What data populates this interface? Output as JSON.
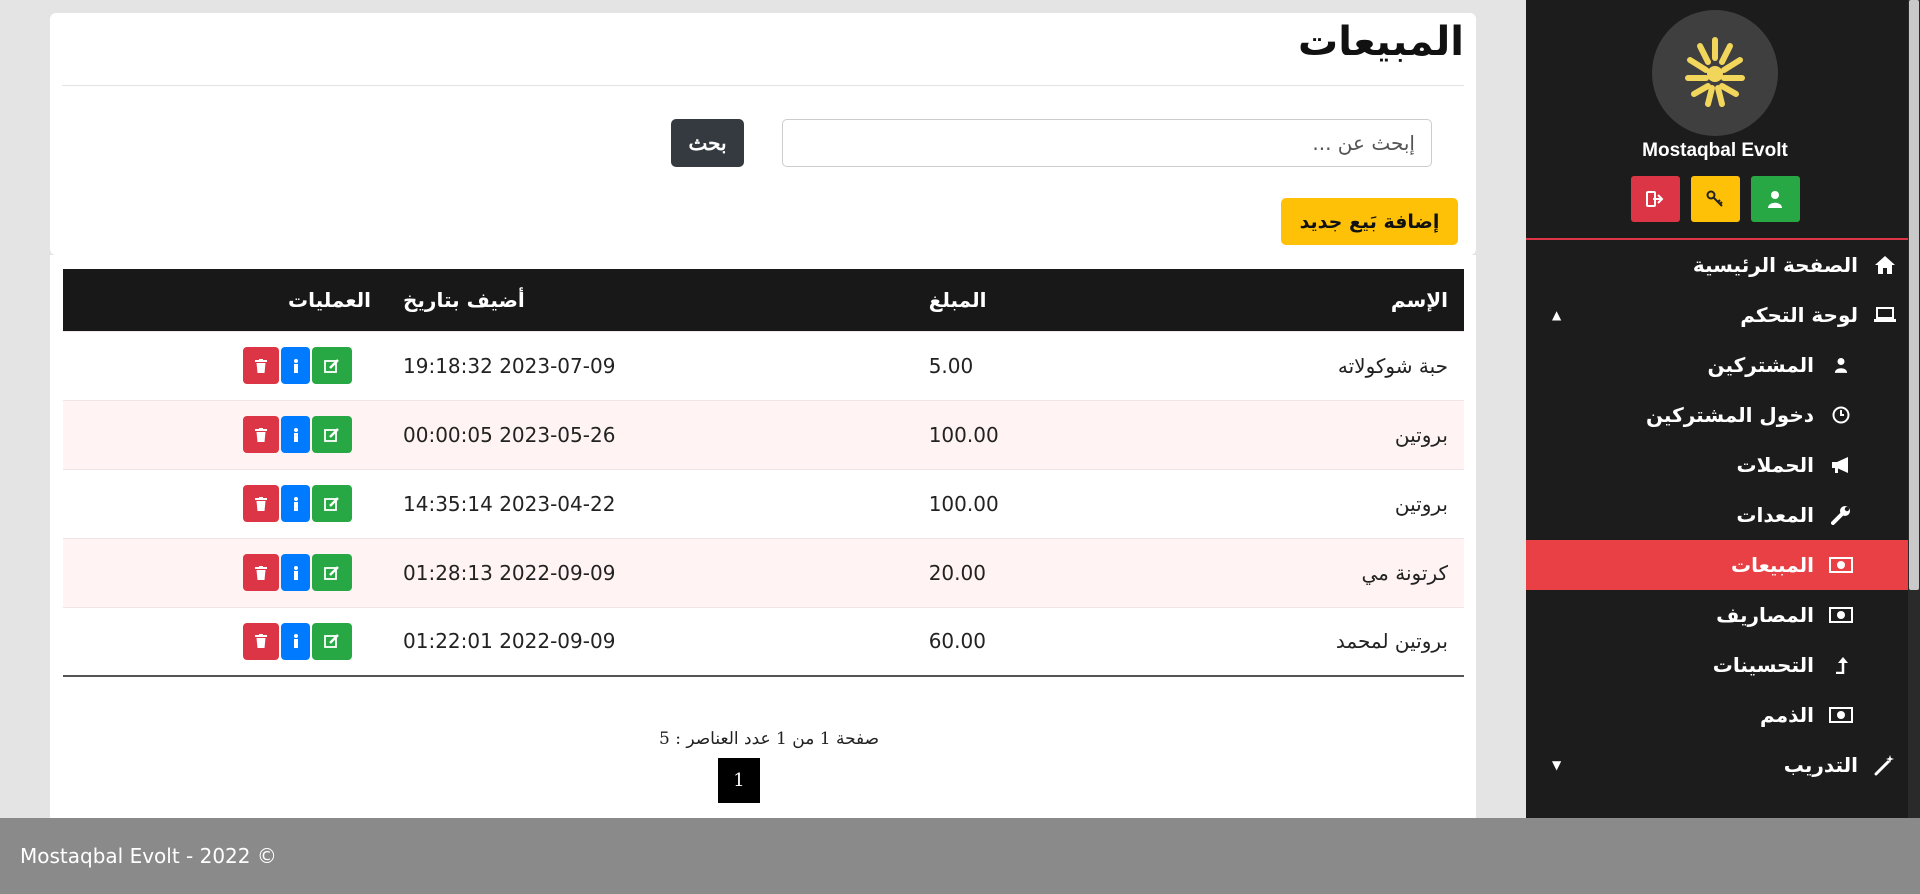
{
  "sidebar": {
    "brand": "Mostaqbal Evolt",
    "quick_buttons": [
      "logout-icon",
      "key-icon",
      "user-icon"
    ],
    "items": [
      {
        "label": "الصفحة الرئيسية",
        "icon": "home-icon"
      },
      {
        "label": "لوحة التحكم",
        "icon": "laptop-icon",
        "caret": "▲"
      },
      {
        "label": "المشتركين",
        "icon": "user-icon"
      },
      {
        "label": "دخول المشتركين",
        "icon": "clock-icon"
      },
      {
        "label": "الحملات",
        "icon": "megaphone-icon"
      },
      {
        "label": "المعدات",
        "icon": "wrench-icon"
      },
      {
        "label": "المبيعات",
        "icon": "money-icon"
      },
      {
        "label": "المصاريف",
        "icon": "money-icon"
      },
      {
        "label": "التحسينات",
        "icon": "arrow-up-icon"
      },
      {
        "label": "الذمم",
        "icon": "money-icon"
      },
      {
        "label": "التدريب",
        "icon": "magic-wand-icon",
        "caret": "▼"
      }
    ]
  },
  "page": {
    "title": "المبيعات",
    "search_placeholder": "إبحث عن ...",
    "search_button": "بحث",
    "add_button": "إضافة بَيع جديد"
  },
  "table": {
    "headers": [
      "الإسم",
      "المبلغ",
      "أضيف بتاريخ",
      "العمليات"
    ],
    "rows": [
      {
        "name": "حبة شوكولاته",
        "amount": "5.00",
        "date": "2023-07-09 19:18:32"
      },
      {
        "name": "بروتين",
        "amount": "100.00",
        "date": "2023-05-26 00:00:05"
      },
      {
        "name": "بروتين",
        "amount": "100.00",
        "date": "2023-04-22 14:35:14"
      },
      {
        "name": "كرتونة مي",
        "amount": "20.00",
        "date": "2022-09-09 01:28:13"
      },
      {
        "name": "بروتين لمحمد",
        "amount": "60.00",
        "date": "2022-09-09 01:22:01"
      }
    ]
  },
  "pagination": {
    "summary": "صفحة 1 من 1 عدد العناصر : 5",
    "current": "1"
  },
  "footer": {
    "text": "Mostaqbal Evolt - 2022 ©"
  },
  "colors": {
    "accent_red": "#dc3545",
    "active_nav": "#e84045",
    "sidebar_bg": "#1c1c1c",
    "yellow": "#ffc107",
    "green": "#28a745",
    "blue": "#007bff"
  }
}
